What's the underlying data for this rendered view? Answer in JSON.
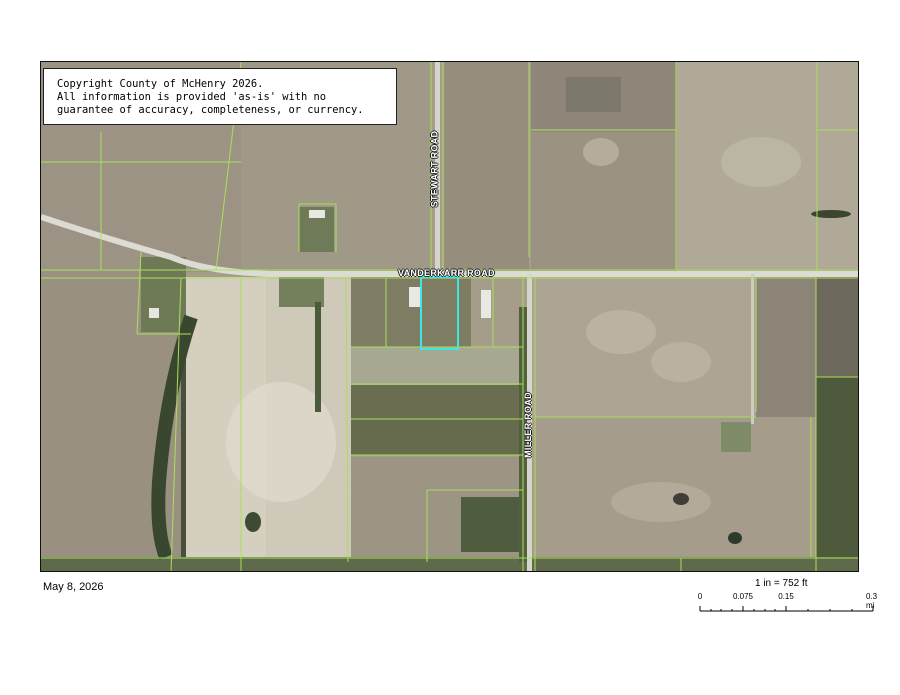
{
  "copyright": {
    "line1": "Copyright County of McHenry 2026.",
    "line2": "All information is provided 'as-is' with no",
    "line3": "guarantee of accuracy, completeness, or currency."
  },
  "roads": {
    "vanderkarr": "VANDERKARR ROAD",
    "stewart": "STEWART ROAD",
    "miller": "MILLER ROAD"
  },
  "footer": {
    "date": "May 8, 2026",
    "scale_ratio": "1 in = 752 ft"
  },
  "scale_bar": {
    "ticks": [
      "0",
      "0.075",
      "0.15",
      "0.3 mi"
    ]
  },
  "colors": {
    "parcel_lines": "#a8e05a",
    "selected_parcel": "#3ee6e6",
    "road_surface": "#dcdcd4",
    "field": "#a89f8d"
  }
}
